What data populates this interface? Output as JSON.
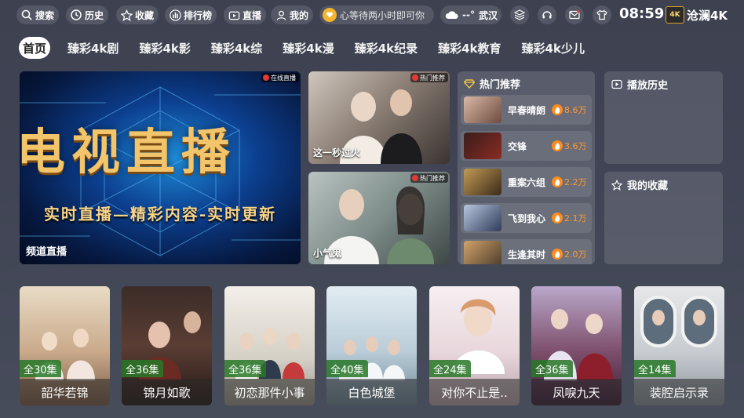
{
  "topbar": {
    "search": "搜索",
    "history": "历史",
    "favorites": "收藏",
    "ranking": "排行榜",
    "live": "直播",
    "mine": "我的",
    "ticker": "心等待两小时即可你",
    "weather_temp": "--°",
    "weather_city": "武汉",
    "time": "08:59",
    "brand_badge": "4K",
    "brand_name": "沧澜4K"
  },
  "tabs": [
    "首页",
    "臻彩4k剧",
    "臻彩4k影",
    "臻彩4k综",
    "臻彩4k漫",
    "臻彩4k纪录",
    "臻彩4k教育",
    "臻彩4k少儿"
  ],
  "hero": {
    "big_text": "电视直播",
    "sub_text": "实时直播—精彩内容-实时更新",
    "caption": "频道直播",
    "tag": "在线直播"
  },
  "mid_cards": [
    {
      "caption": "这一秒过火",
      "tag": "热门推荐"
    },
    {
      "caption": "小气鬼",
      "tag": "热门推荐"
    }
  ],
  "hot": {
    "title": "热门推荐",
    "items": [
      {
        "title": "早春晴朗",
        "heat": "8.6万"
      },
      {
        "title": "交锋",
        "heat": "3.6万"
      },
      {
        "title": "重案六组",
        "heat": "2.2万"
      },
      {
        "title": "飞到我心",
        "heat": "2.1万"
      },
      {
        "title": "生逢其时",
        "heat": "2.0万"
      }
    ]
  },
  "side": {
    "history_title": "播放历史",
    "fav_title": "我的收藏"
  },
  "cards": [
    {
      "title": "韶华若锦",
      "episodes": "全30集"
    },
    {
      "title": "锦月如歌",
      "episodes": "全36集"
    },
    {
      "title": "初恋那件小事",
      "episodes": "全36集"
    },
    {
      "title": "白色城堡",
      "episodes": "全40集"
    },
    {
      "title": "对你不止是..",
      "episodes": "全24集"
    },
    {
      "title": "凤唳九天",
      "episodes": "全36集"
    },
    {
      "title": "装腔启示录",
      "episodes": "全14集"
    }
  ]
}
